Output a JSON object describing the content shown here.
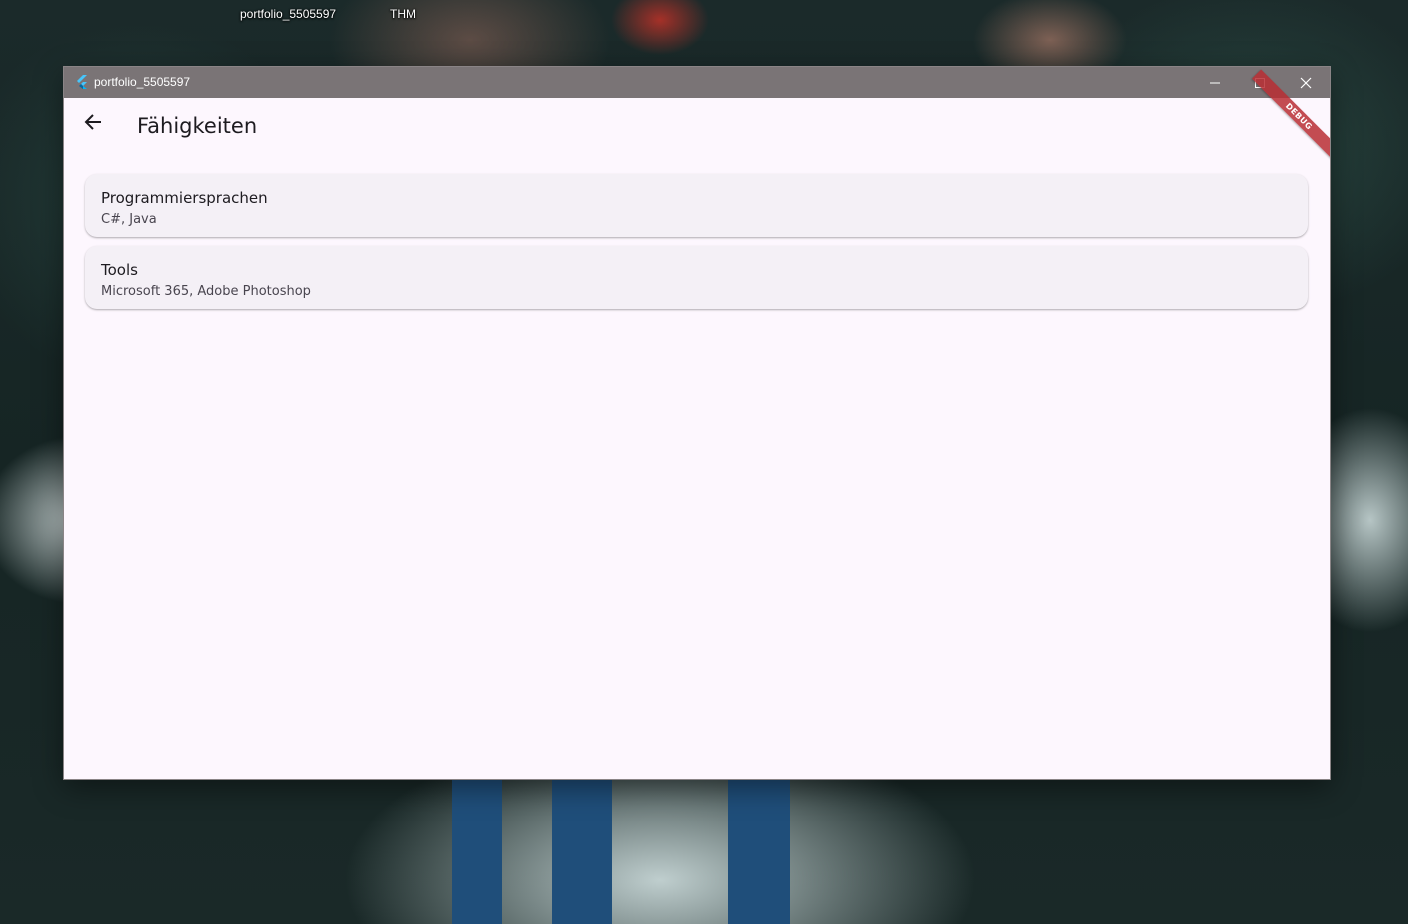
{
  "desktop": {
    "icons": [
      {
        "label": "portfolio_5505597"
      },
      {
        "label": "THM"
      }
    ]
  },
  "window": {
    "title": "portfolio_5505597",
    "app_icon": "flutter-icon",
    "controls": {
      "minimize_icon": "minimize-icon",
      "maximize_icon": "maximize-icon",
      "close_icon": "close-icon"
    }
  },
  "appbar": {
    "back_icon": "arrow-back-icon",
    "title": "Fähigkeiten"
  },
  "debug_banner": {
    "label": "DEBUG",
    "color": "#b82e34"
  },
  "skills": [
    {
      "title": "Programmiersprachen",
      "subtitle": "C#, Java"
    },
    {
      "title": "Tools",
      "subtitle": "Microsoft 365, Adobe Photoshop"
    }
  ],
  "colors": {
    "titlebar": "#7a7476",
    "background": "#fdf7fe",
    "card": "#f4f0f6"
  }
}
